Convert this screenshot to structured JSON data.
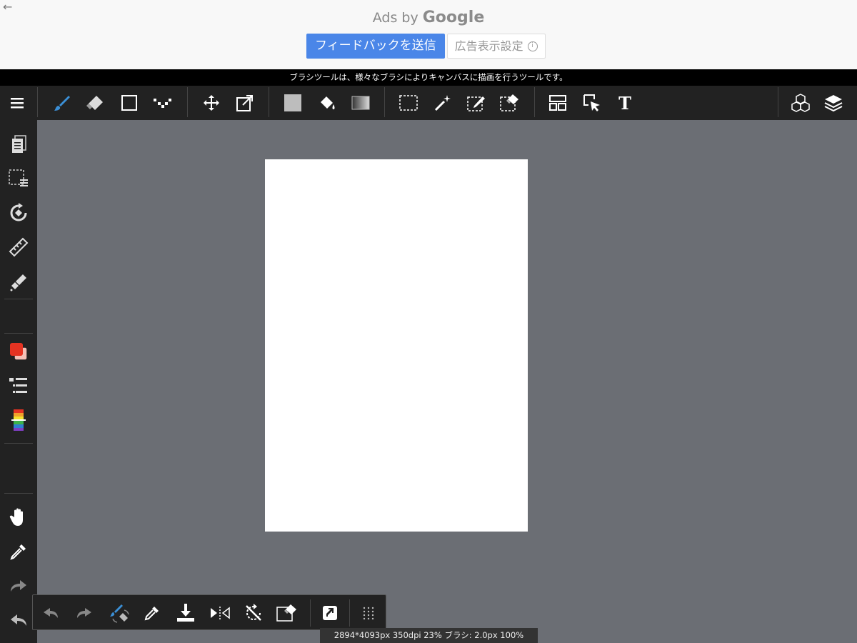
{
  "ad": {
    "back_glyph": "←",
    "ads_by": "Ads by",
    "google": "Google",
    "feedback_button": "フィードバックを送信",
    "settings_button": "広告表示設定",
    "info_glyph": "i"
  },
  "hint": "ブラシツールは、様々なブラシによりキャンバスに描画を行うツールです。",
  "toolbar": {
    "text_tool_glyph": "T",
    "icons": [
      "menu-icon",
      "brush-icon",
      "eraser-icon",
      "shape-icon",
      "dot-icon",
      "move-icon",
      "transform-icon",
      "fill-rect-icon",
      "bucket-icon",
      "gradient-icon",
      "select-rect-icon",
      "magic-wand-icon",
      "select-pen-icon",
      "select-eraser-icon",
      "panel-icon",
      "operation-icon",
      "text-icon",
      "3d-icon",
      "layers-icon"
    ]
  },
  "status": "2894*4093px 350dpi 23% ブラシ: 2.0px 100%",
  "colors": {
    "accent": "#3b8fd6",
    "foreground_color": "#e53322",
    "toolbar_bg": "#222222",
    "canvas_bg": "#6b6e74"
  }
}
